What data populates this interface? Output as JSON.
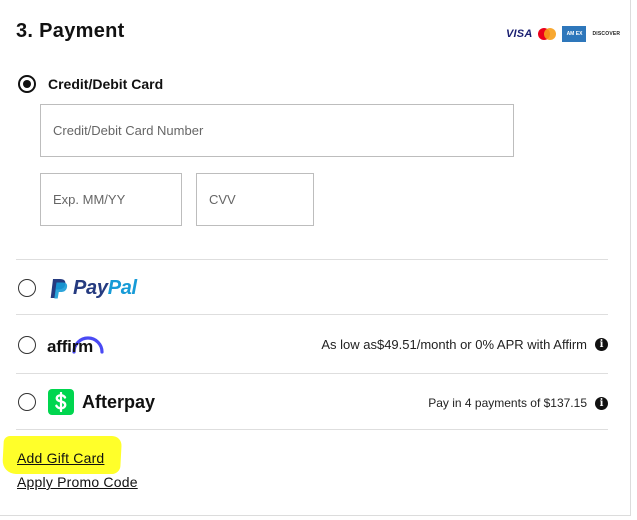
{
  "section": {
    "title": "3. Payment"
  },
  "card_logos": {
    "visa": "VISA",
    "amex": "AM EX",
    "discover": "DISCOVER",
    "colors": {
      "visa": "#1a1f71",
      "mc_red": "#eb001b",
      "mc_orange": "#f79e1b",
      "amex": "#2e77bb"
    }
  },
  "options": {
    "card": {
      "label": "Credit/Debit Card",
      "selected": true,
      "number_placeholder": "Credit/Debit Card Number",
      "expiry_placeholder": "Exp. MM/YY",
      "cvv_placeholder": "CVV"
    },
    "paypal": {
      "pay": "Pay",
      "pal": "Pal",
      "icon": "paypal-p-icon",
      "colors": {
        "pay": "#253b80",
        "pal": "#179bd7"
      }
    },
    "affirm": {
      "label": "affirm",
      "note": "As low as$49.51/month or 0% APR with Affirm",
      "accent": "#4a4af4"
    },
    "afterpay": {
      "label": "Afterpay",
      "icon": "dollar-icon",
      "note": "Pay in 4 payments of $137.15",
      "accent": "#00d64f"
    }
  },
  "info_glyph": "i",
  "links": {
    "gift_card": "Add Gift Card",
    "promo_code": "Apply Promo Code",
    "highlight_color": "#ffff2a"
  }
}
